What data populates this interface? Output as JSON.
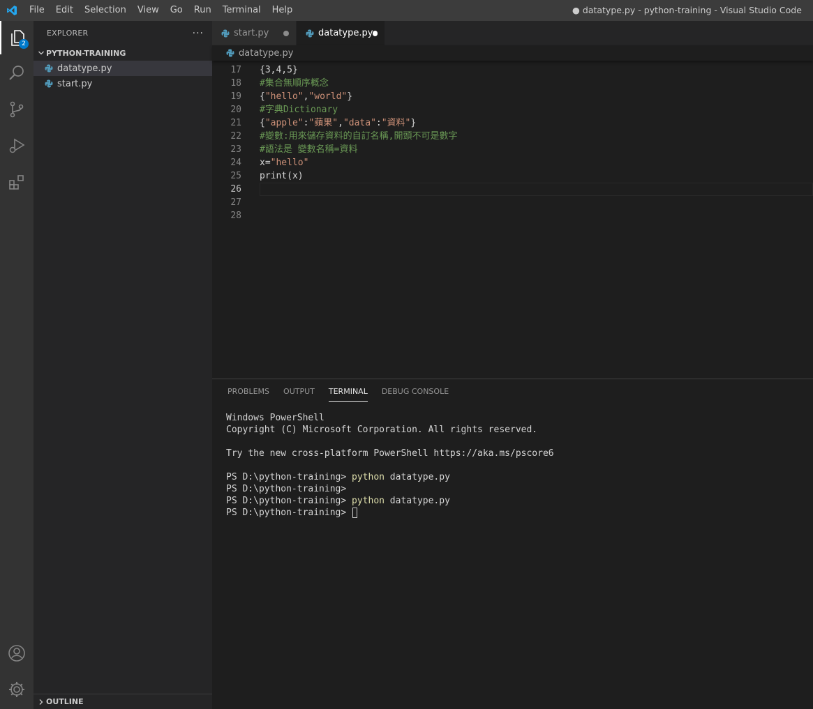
{
  "titlebar": {
    "menu": [
      "File",
      "Edit",
      "Selection",
      "View",
      "Go",
      "Run",
      "Terminal",
      "Help"
    ],
    "window_title": "● datatype.py - python-training - Visual Studio Code"
  },
  "activitybar": {
    "explorer_badge": "2",
    "icons": [
      "explorer-icon",
      "search-icon",
      "source-control-icon",
      "run-debug-icon",
      "extensions-icon",
      "account-icon",
      "settings-gear-icon"
    ]
  },
  "sidebar": {
    "title": "EXPLORER",
    "more": "···",
    "folder": "PYTHON-TRAINING",
    "files": [
      "datatype.py",
      "start.py"
    ],
    "outline": "OUTLINE"
  },
  "tabs": [
    {
      "label": "start.py",
      "dirty": true,
      "active": false
    },
    {
      "label": "datatype.py",
      "dirty": true,
      "active": true
    }
  ],
  "breadcrumb": "datatype.py",
  "editor": {
    "lines": [
      {
        "n": "17",
        "tokens": [
          {
            "t": "{3,4,5}",
            "c": "plain"
          }
        ]
      },
      {
        "n": "18",
        "tokens": [
          {
            "t": "#集合無順序概念",
            "c": "comment"
          }
        ]
      },
      {
        "n": "19",
        "tokens": [
          {
            "t": "{",
            "c": "plain"
          },
          {
            "t": "\"hello\"",
            "c": "string"
          },
          {
            "t": ",",
            "c": "plain"
          },
          {
            "t": "\"world\"",
            "c": "string"
          },
          {
            "t": "}",
            "c": "plain"
          }
        ]
      },
      {
        "n": "20",
        "tokens": [
          {
            "t": "#字典Dictionary",
            "c": "comment"
          }
        ]
      },
      {
        "n": "21",
        "tokens": [
          {
            "t": "{",
            "c": "plain"
          },
          {
            "t": "\"apple\"",
            "c": "string"
          },
          {
            "t": ":",
            "c": "plain"
          },
          {
            "t": "\"蘋果\"",
            "c": "string"
          },
          {
            "t": ",",
            "c": "plain"
          },
          {
            "t": "\"data\"",
            "c": "string"
          },
          {
            "t": ":",
            "c": "plain"
          },
          {
            "t": "\"資料\"",
            "c": "string"
          },
          {
            "t": "}",
            "c": "plain"
          }
        ]
      },
      {
        "n": "22",
        "tokens": [
          {
            "t": "#變數:用來儲存資料的自訂名稱,開頭不可是數字",
            "c": "comment"
          }
        ]
      },
      {
        "n": "23",
        "tokens": [
          {
            "t": "#語法是 變數名稱=資料",
            "c": "comment"
          }
        ]
      },
      {
        "n": "24",
        "tokens": [
          {
            "t": "x=",
            "c": "plain"
          },
          {
            "t": "\"hello\"",
            "c": "string"
          }
        ]
      },
      {
        "n": "25",
        "tokens": [
          {
            "t": "print",
            "c": "func"
          },
          {
            "t": "(x)",
            "c": "plain"
          }
        ]
      },
      {
        "n": "26",
        "tokens": [],
        "current": true
      },
      {
        "n": "27",
        "tokens": []
      },
      {
        "n": "28",
        "tokens": []
      }
    ]
  },
  "panel": {
    "tabs": [
      "PROBLEMS",
      "OUTPUT",
      "TERMINAL",
      "DEBUG CONSOLE"
    ],
    "active_tab": "TERMINAL",
    "terminal_lines": [
      [
        {
          "t": "Windows PowerShell",
          "c": "plain"
        }
      ],
      [
        {
          "t": "Copyright (C) Microsoft Corporation. All rights reserved.",
          "c": "plain"
        }
      ],
      [],
      [
        {
          "t": "Try the new cross-platform PowerShell https://aka.ms/pscore6",
          "c": "plain"
        }
      ],
      [],
      [
        {
          "t": "PS D:\\python-training> ",
          "c": "plain"
        },
        {
          "t": "python",
          "c": "cmd"
        },
        {
          "t": " datatype.py",
          "c": "plain"
        }
      ],
      [
        {
          "t": "PS D:\\python-training>",
          "c": "plain"
        }
      ],
      [
        {
          "t": "PS D:\\python-training> ",
          "c": "plain"
        },
        {
          "t": "python",
          "c": "cmd"
        },
        {
          "t": " datatype.py",
          "c": "plain"
        }
      ],
      [
        {
          "t": "PS D:\\python-training> ",
          "c": "plain"
        },
        {
          "t": "",
          "c": "cursor"
        }
      ]
    ]
  },
  "colors": {
    "accent": "#007acc",
    "comment": "#6a9955",
    "string": "#ce9178",
    "terminal_command": "#dcdcaa"
  }
}
